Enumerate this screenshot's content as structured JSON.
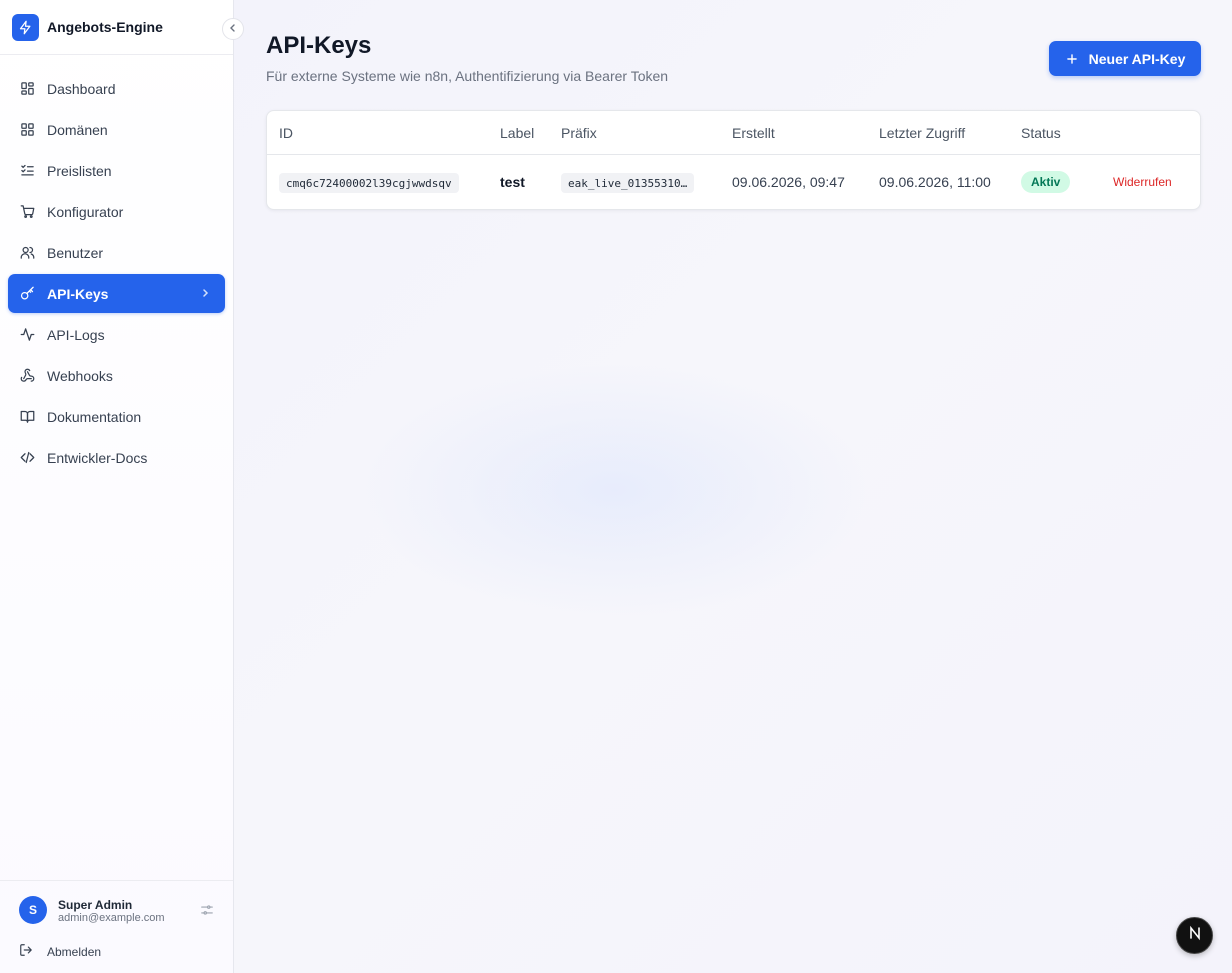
{
  "app": {
    "name": "Angebots-Engine",
    "logo_icon": "bolt-icon",
    "accent": "#2563eb"
  },
  "sidebar": {
    "items": [
      {
        "label": "Dashboard",
        "icon": "grid-icon",
        "active": false
      },
      {
        "label": "Domänen",
        "icon": "grid-icon",
        "active": false
      },
      {
        "label": "Preislisten",
        "icon": "list-checks-icon",
        "active": false
      },
      {
        "label": "Konfigurator",
        "icon": "cart-icon",
        "active": false
      },
      {
        "label": "Benutzer",
        "icon": "users-icon",
        "active": false
      },
      {
        "label": "API-Keys",
        "icon": "key-icon",
        "active": true
      },
      {
        "label": "API-Logs",
        "icon": "activity-icon",
        "active": false
      },
      {
        "label": "Webhooks",
        "icon": "webhook-icon",
        "active": false
      },
      {
        "label": "Dokumentation",
        "icon": "book-icon",
        "active": false
      },
      {
        "label": "Entwickler-Docs",
        "icon": "code-icon",
        "active": false
      }
    ],
    "user": {
      "initial": "S",
      "name": "Super Admin",
      "email": "admin@example.com"
    },
    "logout_label": "Abmelden"
  },
  "page": {
    "title": "API-Keys",
    "subtitle": "Für externe Systeme wie n8n, Authentifizierung via Bearer Token",
    "new_button_label": "Neuer API-Key"
  },
  "table": {
    "columns": [
      "ID",
      "Label",
      "Präfix",
      "Erstellt",
      "Letzter Zugriff",
      "Status"
    ],
    "rows": [
      {
        "id": "cmq6c72400002l39cgjwwdsqv",
        "label": "test",
        "prefix": "eak_live_01355310…",
        "created": "09.06.2026, 09:47",
        "last_access": "09.06.2026, 11:00",
        "status": "Aktiv",
        "status_color": "#047857",
        "action": "Widerrufen",
        "action_color": "#dc2626"
      }
    ]
  },
  "floating_badge": {
    "text": "N"
  }
}
